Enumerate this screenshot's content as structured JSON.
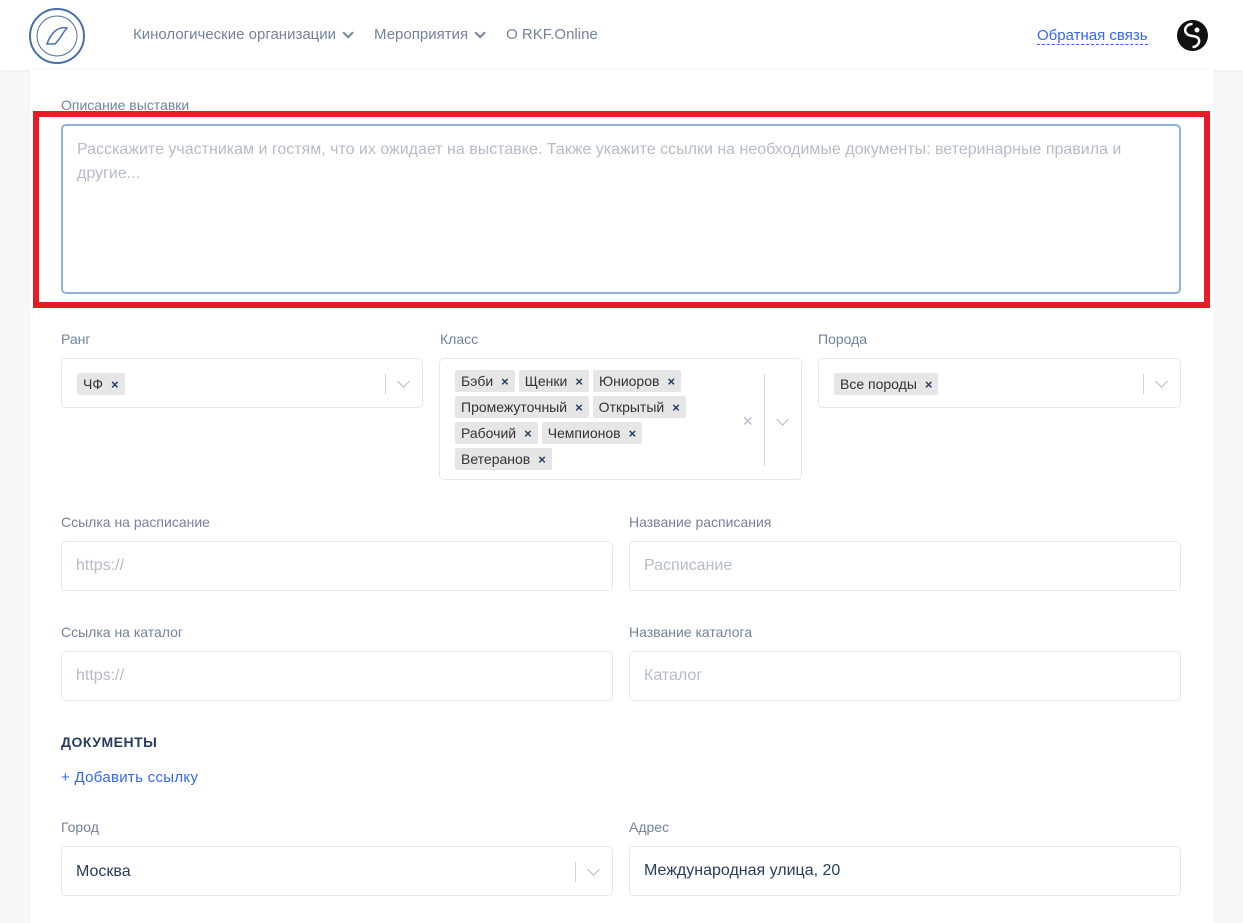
{
  "header": {
    "nav": [
      {
        "label": "Кинологические организации",
        "has_dropdown": true
      },
      {
        "label": "Мероприятия",
        "has_dropdown": true
      },
      {
        "label": "О RKF.Online",
        "has_dropdown": false
      }
    ],
    "feedback_link": "Обратная связь",
    "logo_icon": "rkf-logo-icon",
    "avatar_icon": "user-avatar-icon"
  },
  "form": {
    "description": {
      "label": "Описание выставки",
      "placeholder": "Расскажите участникам и гостям, что их ожидает на выставке. Также укажите ссылки на необходимые документы: ветеринарные правила и другие..."
    },
    "rank": {
      "label": "Ранг",
      "tags": [
        "ЧФ"
      ]
    },
    "class": {
      "label": "Класс",
      "tags": [
        "Бэби",
        "Щенки",
        "Юниоров",
        "Промежуточный",
        "Открытый",
        "Рабочий",
        "Чемпионов",
        "Ветеранов"
      ]
    },
    "breed": {
      "label": "Порода",
      "tags": [
        "Все породы"
      ]
    },
    "schedule_link": {
      "label": "Ссылка на расписание",
      "placeholder": "https://"
    },
    "schedule_name": {
      "label": "Название расписания",
      "placeholder": "Расписание"
    },
    "catalog_link": {
      "label": "Ссылка на каталог",
      "placeholder": "https://"
    },
    "catalog_name": {
      "label": "Название каталога",
      "placeholder": "Каталог"
    },
    "documents": {
      "title": "ДОКУМЕНТЫ",
      "add_link": "+ Добавить ссылку"
    },
    "city": {
      "label": "Город",
      "value": "Москва"
    },
    "address": {
      "label": "Адрес",
      "value": "Международная улица, 20"
    }
  },
  "colors": {
    "accent": "#3366ff",
    "highlight": "#e81c24",
    "text": "#253c5e",
    "muted": "#72839c"
  }
}
